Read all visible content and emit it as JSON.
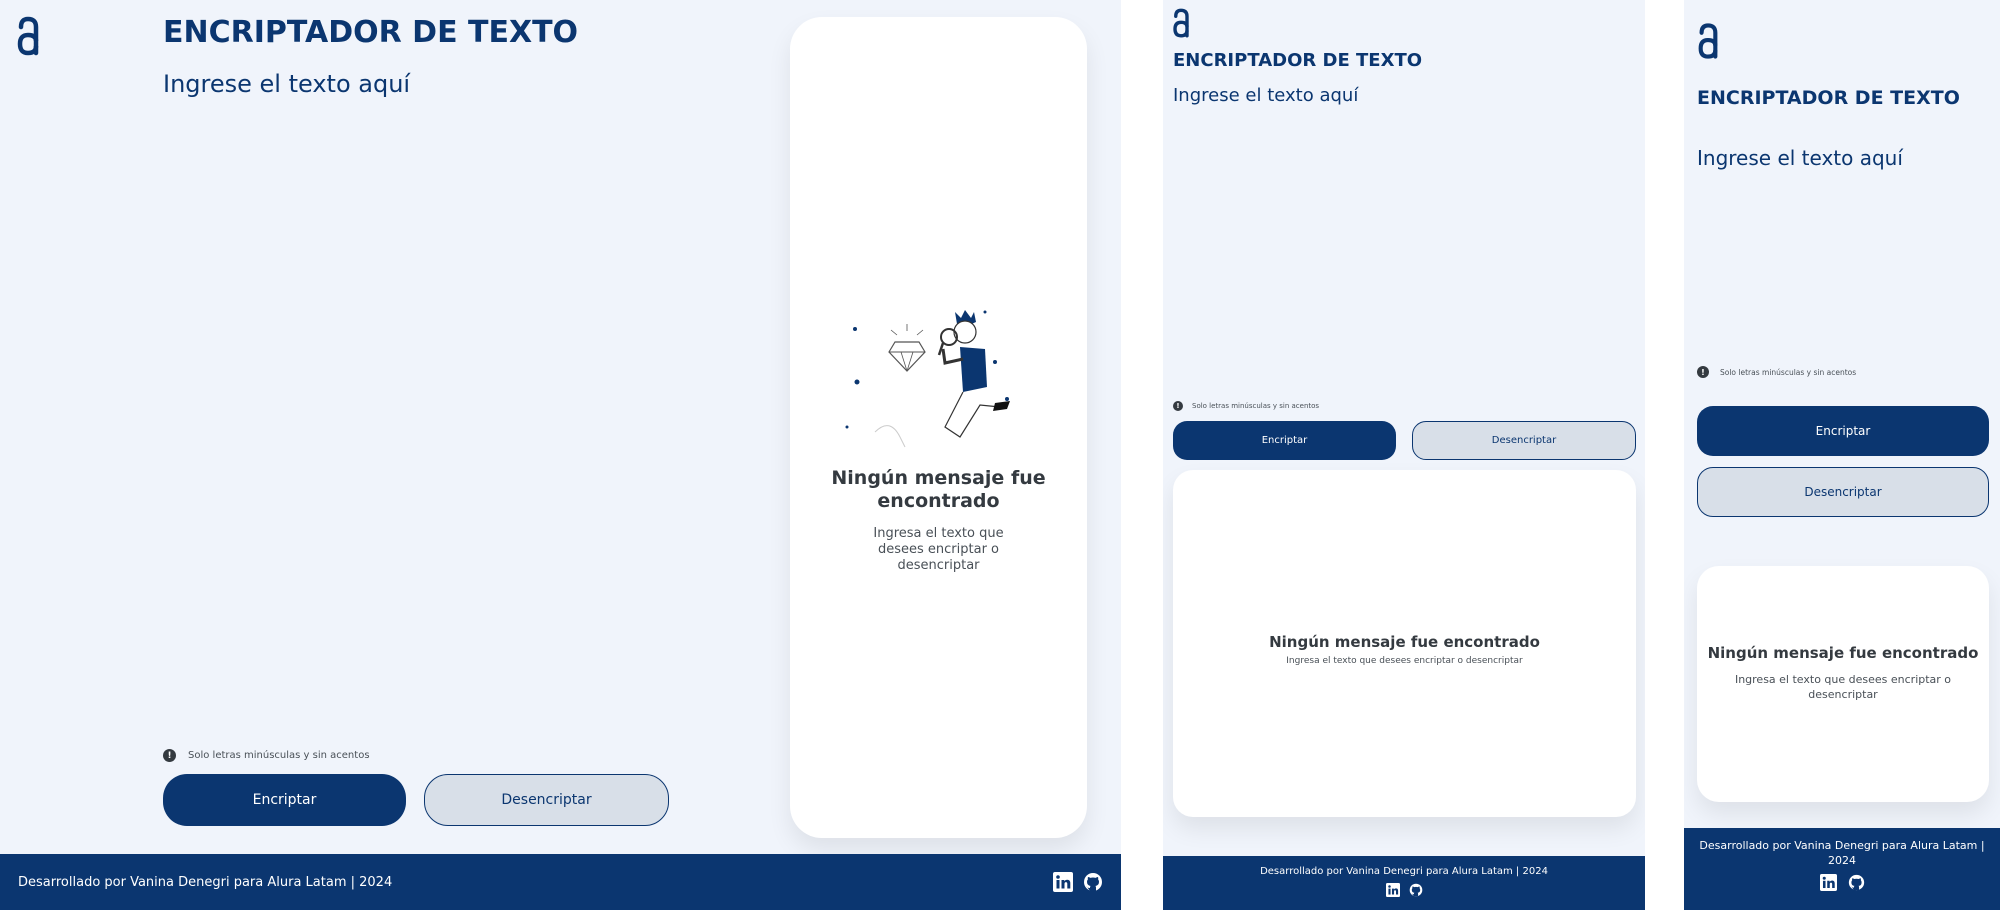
{
  "app": {
    "title": "ENCRIPTADOR DE TEXTO",
    "input_placeholder": "Ingrese el texto aquí",
    "hint": "Solo letras minúsculas y sin acentos",
    "hint_icon": "info-circle-icon",
    "encrypt_label": "Encriptar",
    "decrypt_label": "Desencriptar",
    "empty_title": "Ningún mensaje fue encontrado",
    "empty_subtitle": "Ingresa el texto que desees encriptar o desencriptar",
    "footer_text": "Desarrollado por Vanina Denegri para Alura Latam | 2024",
    "social_icons": [
      "linkedin-icon",
      "github-icon"
    ]
  },
  "colors": {
    "primary": "#0b3670",
    "background": "#f0f4fb",
    "card": "#ffffff",
    "secondary_button": "#d8dfe8",
    "text_dark": "#343a40"
  }
}
